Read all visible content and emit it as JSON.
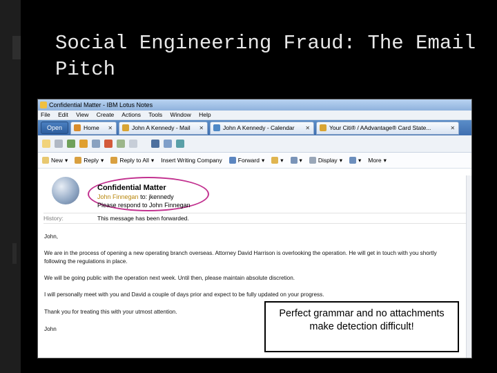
{
  "slide": {
    "title": "Social Engineering Fraud: The Email Pitch",
    "callout": "Perfect grammar and no attachments make detection difficult!"
  },
  "window": {
    "title": "Confidential Matter - IBM Lotus Notes",
    "menu": [
      "File",
      "Edit",
      "View",
      "Create",
      "Actions",
      "Tools",
      "Window",
      "Help"
    ]
  },
  "tabs": {
    "open_label": "Open",
    "items": [
      {
        "label": "Home",
        "icon": "home-icon",
        "color": "#d98c2a"
      },
      {
        "label": "John A Kennedy - Mail",
        "icon": "mail-icon",
        "color": "#d9a533"
      },
      {
        "label": "John A Kennedy - Calendar",
        "icon": "calendar-icon",
        "color": "#4f89c6"
      },
      {
        "label": "Your Citi® / AAdvantage® Card State...",
        "icon": "mail-icon",
        "color": "#d9a533"
      }
    ]
  },
  "actions": [
    {
      "label": "New",
      "dropdown": true
    },
    {
      "label": "Reply",
      "dropdown": true
    },
    {
      "label": "Reply to All",
      "dropdown": true
    },
    {
      "label": "Insert Writing Company",
      "dropdown": false
    },
    {
      "label": "Forward",
      "dropdown": true
    },
    {
      "label": "",
      "dropdown": true
    },
    {
      "label": "",
      "dropdown": true
    },
    {
      "label": "Display",
      "dropdown": true
    },
    {
      "label": "",
      "dropdown": true
    },
    {
      "label": "More",
      "dropdown": true
    }
  ],
  "email": {
    "subject": "Confidential Matter",
    "from": "John Finnegan",
    "to_label": "to:",
    "to": "jkennedy",
    "respond": "Please respond to John Finnegan",
    "history_label": "History:",
    "history_value": "This message has been forwarded.",
    "greeting": "John,",
    "paragraph1_line1": "We are in the process of opening a new operating branch overseas. Attorney David Harrison is overlooking the operation. He will get in touch with you shortly",
    "paragraph1_line2": "following the regulations in place.",
    "paragraph2": "We will be going public with the operation next week. Until then, please maintain absolute discretion.",
    "paragraph3": "I will personally meet with you and David a couple of days prior and expect to be fully updated on your progress.",
    "closing": "Thank you for treating this with your utmost attention.",
    "signature": "John"
  },
  "colors": {
    "highlight_oval": "#c2318f",
    "tab_bar": "#3f6fb0"
  }
}
